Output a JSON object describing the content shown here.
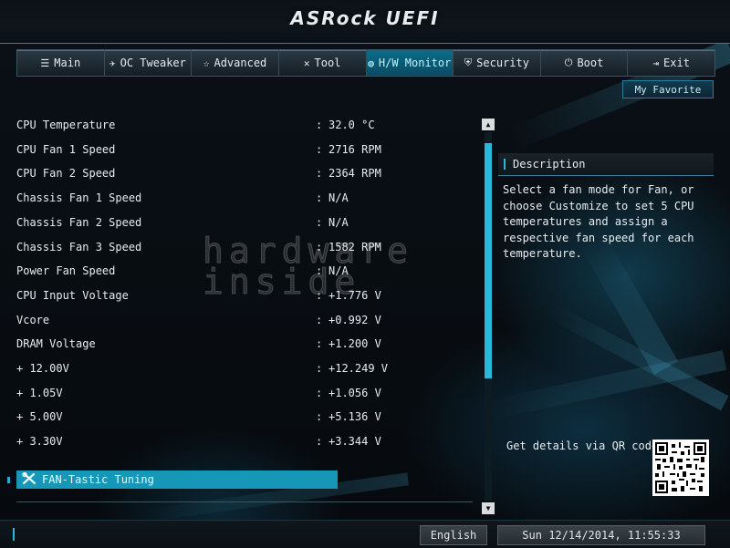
{
  "header": {
    "brand": "ASRock UEFI"
  },
  "nav": {
    "tabs": [
      {
        "label": "Main",
        "icon": "list-icon",
        "glyph": "☰",
        "active": false
      },
      {
        "label": "OC Tweaker",
        "icon": "rocket-icon",
        "glyph": "✈",
        "active": false
      },
      {
        "label": "Advanced",
        "icon": "star-icon",
        "glyph": "☆",
        "active": false
      },
      {
        "label": "Tool",
        "icon": "tools-icon",
        "glyph": "✕",
        "active": false
      },
      {
        "label": "H/W Monitor",
        "icon": "globe-icon",
        "glyph": "◍",
        "active": true
      },
      {
        "label": "Security",
        "icon": "shield-icon",
        "glyph": "⛨",
        "active": false
      },
      {
        "label": "Boot",
        "icon": "power-icon",
        "glyph": "⏻",
        "active": false
      },
      {
        "label": "Exit",
        "icon": "exit-icon",
        "glyph": "⇥",
        "active": false
      }
    ]
  },
  "my_favorite": "My Favorite",
  "watermark": {
    "line1": "hardware",
    "line2": "inside"
  },
  "params": [
    {
      "label": "CPU Temperature",
      "value": "32.0 °C"
    },
    {
      "label": "CPU Fan 1 Speed",
      "value": "2716 RPM"
    },
    {
      "label": "CPU Fan 2 Speed",
      "value": "2364 RPM"
    },
    {
      "label": "Chassis Fan 1 Speed",
      "value": "N/A"
    },
    {
      "label": "Chassis Fan 2 Speed",
      "value": "N/A"
    },
    {
      "label": "Chassis Fan 3 Speed",
      "value": "1582 RPM"
    },
    {
      "label": "Power Fan Speed",
      "value": "N/A"
    },
    {
      "label": "CPU Input Voltage",
      "value": "+1.776 V"
    },
    {
      "label": "Vcore",
      "value": "+0.992 V"
    },
    {
      "label": "DRAM Voltage",
      "value": "+1.200 V"
    },
    {
      "label": "+ 12.00V",
      "value": "+12.249 V"
    },
    {
      "label": "+ 1.05V",
      "value": "+1.056 V"
    },
    {
      "label": "+ 5.00V",
      "value": "+5.136 V"
    },
    {
      "label": "+ 3.30V",
      "value": "+3.344 V"
    }
  ],
  "fan_tuning": {
    "label": "FAN-Tastic Tuning",
    "icon": "wrench-screwdriver-icon"
  },
  "description": {
    "title": "Description",
    "text": "Select a fan mode for Fan, or choose Customize to set 5 CPU temperatures and assign a respective fan speed for each temperature."
  },
  "qr": {
    "label": "Get details via QR code"
  },
  "footer": {
    "language": "English",
    "datetime": "Sun 12/14/2014, 11:55:33"
  },
  "colors": {
    "accent": "#29b8dc",
    "active_tab": "#0a6c8a",
    "highlight": "#1697b7"
  }
}
